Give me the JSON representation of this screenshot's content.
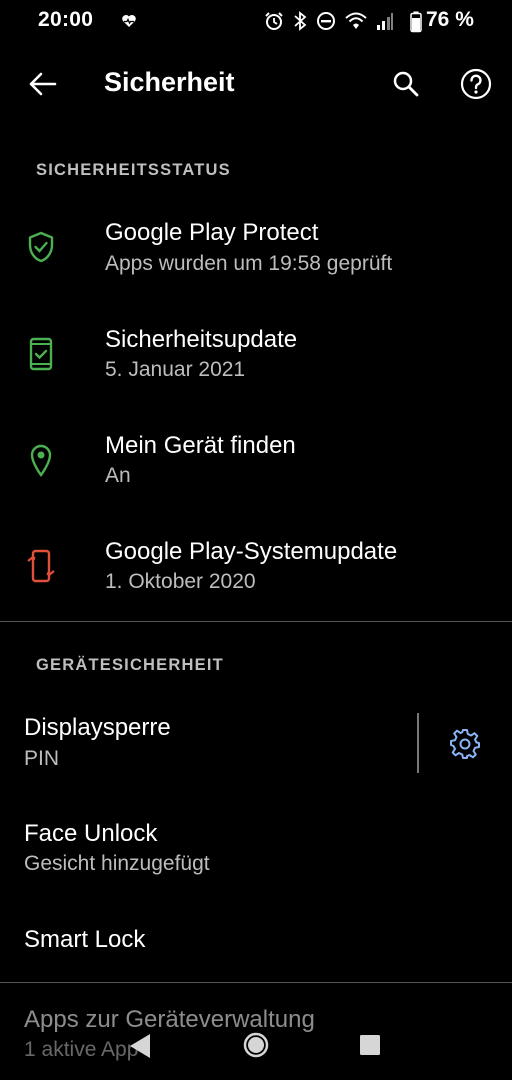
{
  "status_bar": {
    "time": "20:00",
    "battery_percent": "76 %",
    "icons": [
      "heart-pulse-icon",
      "alarm-icon",
      "bluetooth-icon",
      "dnd-icon",
      "wifi-icon",
      "signal-icon",
      "battery-icon"
    ]
  },
  "toolbar": {
    "title": "Sicherheit",
    "back_icon": "arrow-left-icon",
    "search_icon": "search-icon",
    "help_icon": "help-icon"
  },
  "sections": [
    {
      "header": "SICHERHEITSSTATUS",
      "items": [
        {
          "title": "Google Play Protect",
          "subtitle": "Apps wurden um 19:58 geprüft",
          "icon": "shield-check-icon",
          "icon_color": "#4caf50"
        },
        {
          "title": "Sicherheitsupdate",
          "subtitle": "5. Januar 2021",
          "icon": "phone-check-icon",
          "icon_color": "#4caf50"
        },
        {
          "title": "Mein Gerät finden",
          "subtitle": "An",
          "icon": "location-pin-icon",
          "icon_color": "#4caf50"
        },
        {
          "title": "Google Play-Systemupdate",
          "subtitle": "1. Oktober 2020",
          "icon": "phone-update-icon",
          "icon_color": "#e0503a"
        }
      ]
    },
    {
      "header": "GERÄTESICHERHEIT",
      "items": [
        {
          "title": "Displaysperre",
          "subtitle": "PIN",
          "action_icon": "gear-icon",
          "action_color": "#8ab4f8"
        },
        {
          "title": "Face Unlock",
          "subtitle": "Gesicht hinzugefügt"
        },
        {
          "title": "Smart Lock",
          "subtitle": ""
        },
        {
          "title": "Apps zur Geräteverwaltung",
          "subtitle": "1 aktive App"
        }
      ]
    }
  ],
  "nav_bar": {
    "back_icon": "nav-back-icon",
    "home_icon": "nav-home-icon",
    "recents_icon": "nav-recents-icon"
  }
}
